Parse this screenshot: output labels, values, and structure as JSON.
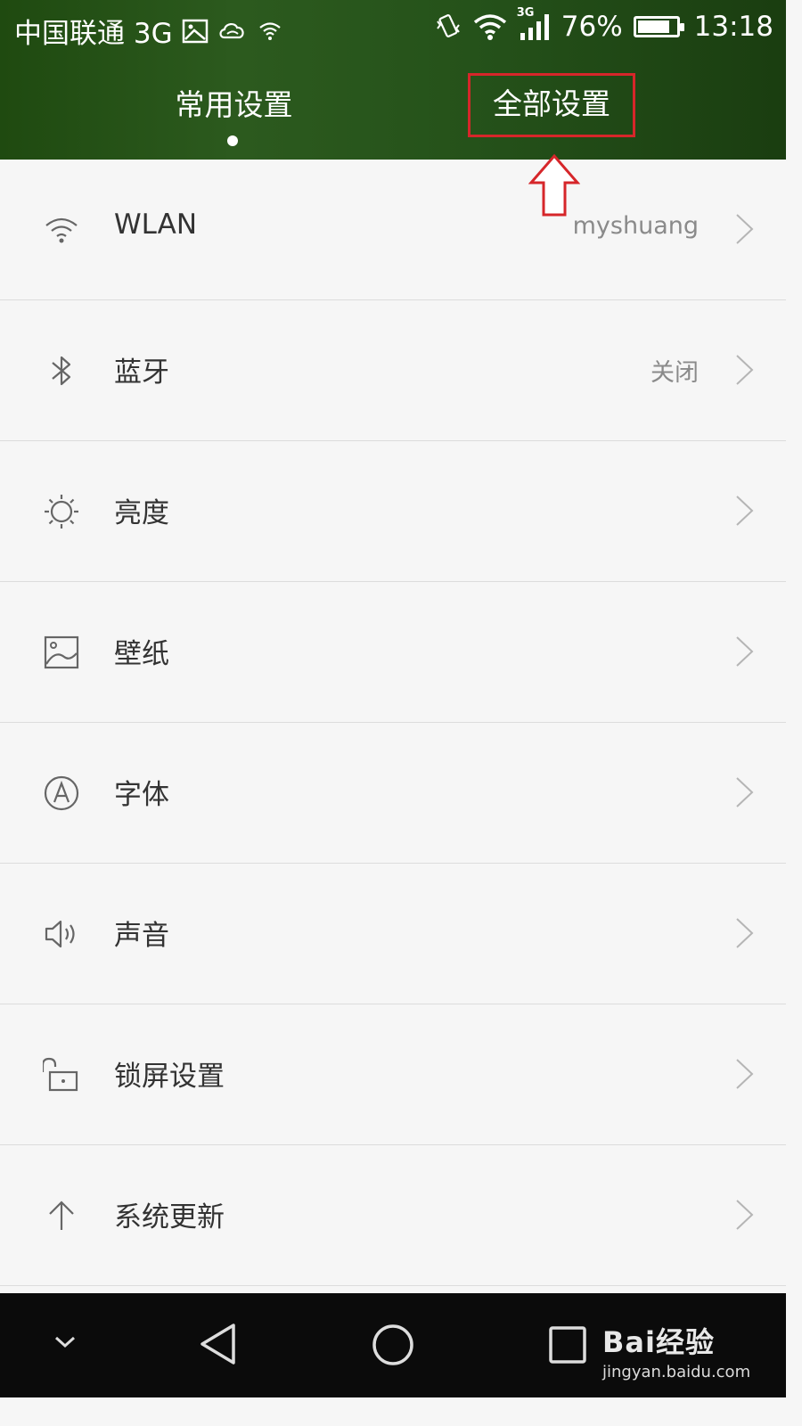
{
  "status_bar": {
    "carrier": "中国联通 3G",
    "network_badge": "3G",
    "battery_text": "76%",
    "battery_level": 0.76,
    "time": "13:18"
  },
  "tabs": [
    {
      "label": "常用设置",
      "selected": true
    },
    {
      "label": "全部设置",
      "selected": false
    }
  ],
  "settings": [
    {
      "label": "WLAN",
      "value": "myshuang",
      "icon": "wifi-icon"
    },
    {
      "label": "蓝牙",
      "value": "关闭",
      "icon": "bluetooth-icon"
    },
    {
      "label": "亮度",
      "value": "",
      "icon": "brightness-icon"
    },
    {
      "label": "壁纸",
      "value": "",
      "icon": "wallpaper-icon"
    },
    {
      "label": "字体",
      "value": "",
      "icon": "font-icon"
    },
    {
      "label": "声音",
      "value": "",
      "icon": "sound-icon"
    },
    {
      "label": "锁屏设置",
      "value": "",
      "icon": "lock-icon"
    },
    {
      "label": "系统更新",
      "value": "",
      "icon": "update-icon"
    }
  ],
  "watermark": {
    "brand": "Bai经验",
    "url": "jingyan.baidu.com"
  },
  "colors": {
    "header": "#25521a",
    "annotation": "#d6262a",
    "background": "#f6f6f6"
  }
}
